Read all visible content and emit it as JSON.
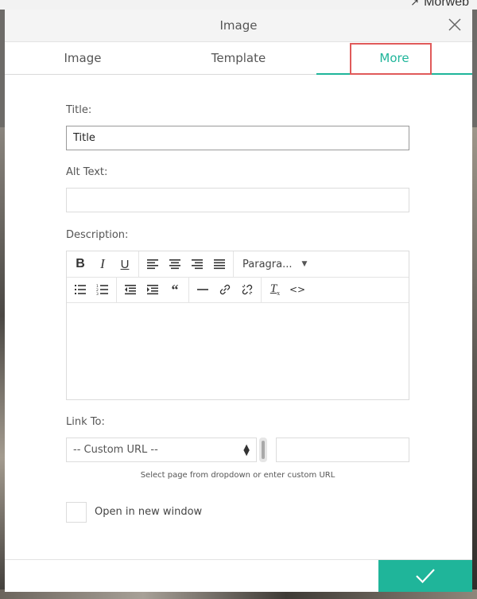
{
  "background": {
    "top_right_text": "Morweb"
  },
  "modal": {
    "title": "Image",
    "tabs": [
      {
        "label": "Image",
        "active": false
      },
      {
        "label": "Template",
        "active": false
      },
      {
        "label": "More",
        "active": true
      }
    ],
    "accent_color": "#1fb59a",
    "highlight_color": "#e05a5a"
  },
  "form": {
    "title_label": "Title:",
    "title_value": "Title",
    "alt_label": "Alt Text:",
    "alt_value": "",
    "description_label": "Description:",
    "editor": {
      "format_select": "Paragra...",
      "toolbar_row1": [
        "bold-icon",
        "italic-icon",
        "underline-icon",
        "align-left-icon",
        "align-center-icon",
        "align-right-icon",
        "align-justify-icon"
      ],
      "toolbar_row2": [
        "bullet-list-icon",
        "numbered-list-icon",
        "outdent-icon",
        "indent-icon",
        "blockquote-icon",
        "horizontal-rule-icon",
        "link-icon",
        "unlink-icon",
        "clear-format-icon",
        "source-code-icon"
      ]
    },
    "link_label": "Link To:",
    "link_select_value": "-- Custom URL --",
    "custom_url_value": "",
    "hint": "Select page from dropdown or enter custom URL",
    "new_window_label": "Open in new window",
    "new_window_checked": false
  }
}
